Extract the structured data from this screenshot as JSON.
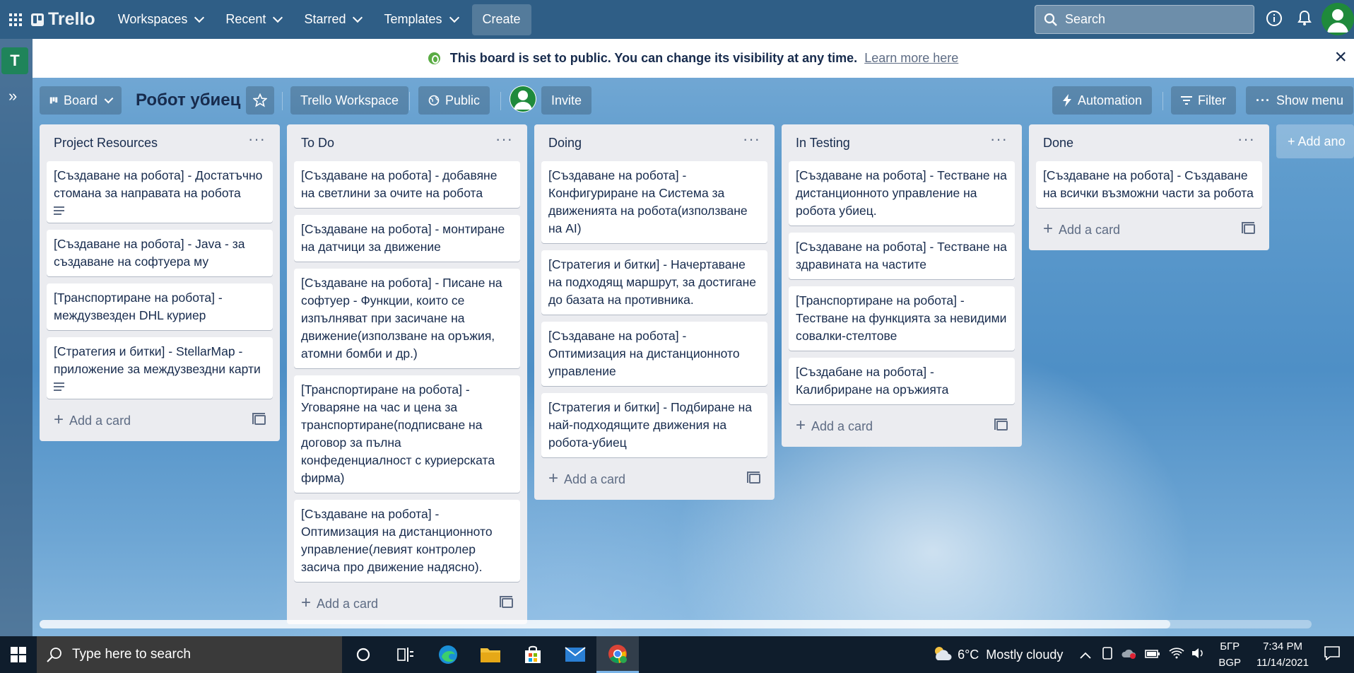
{
  "topnav": {
    "logo": "Trello",
    "workspaces": "Workspaces",
    "recent": "Recent",
    "starred": "Starred",
    "templates": "Templates",
    "create": "Create",
    "search_placeholder": "Search"
  },
  "sidebar": {
    "workspace_initial": "T"
  },
  "banner": {
    "message": "This board is set to public. You can change its visibility at any time.",
    "link": "Learn more here"
  },
  "boardbar": {
    "view": "Board",
    "title": "Робот убиец",
    "workspace": "Trello Workspace",
    "visibility": "Public",
    "invite": "Invite",
    "automation": "Automation",
    "filter": "Filter",
    "show_menu": "Show menu"
  },
  "lists": [
    {
      "title": "Project Resources",
      "cards": [
        {
          "text": "[Създаване на робота] - Достатъчно стомана за направата на робота",
          "desc": true
        },
        {
          "text": "[Създаване на робота] - Java - за създаване на софтуера му",
          "desc": false
        },
        {
          "text": "[Транспортиране на робота] - междузвезден DHL куриер",
          "desc": false
        },
        {
          "text": "[Стратегия и битки] - StellarMap - приложение за междузвездни карти",
          "desc": true
        }
      ],
      "add_card": "Add a card"
    },
    {
      "title": "To Do",
      "cards": [
        {
          "text": "[Създаване на робота] - добавяне на светлини за очите на робота",
          "desc": false
        },
        {
          "text": "[Създаване на робота] - монтиране на датчици за движение",
          "desc": false
        },
        {
          "text": "[Създаване на робота] - Писане на софтуер - Функции, които се изпълняват при засичане на движение(използване на оръжия, атомни бомби и др.)",
          "desc": false
        },
        {
          "text": "[Транспортиране на робота] - Уговаряне на час и цена за транспортиране(подписване на договор за пълна конфеденциалност с куриерската фирма)",
          "desc": false
        },
        {
          "text": "[Създаване на робота] - Оптимизация на дистанционното управление(левият контролер засича про движение надясно).",
          "desc": false
        }
      ],
      "add_card": "Add a card"
    },
    {
      "title": "Doing",
      "cards": [
        {
          "text": "[Създаване на робота] - Конфигуриране на Система за движенията на робота(използване на AI)",
          "desc": false
        },
        {
          "text": "[Стратегия и битки] - Начертаване на подходящ маршрут, за достигане до базата на противника.",
          "desc": false
        },
        {
          "text": "[Създаване на робота] - Оптимизация на дистанционното управление",
          "desc": false
        },
        {
          "text": "[Стратегия и битки] - Подбиране на най-подходящите движения на робота-убиец",
          "desc": false
        }
      ],
      "add_card": "Add a card"
    },
    {
      "title": "In Testing",
      "cards": [
        {
          "text": "[Създаване на робота] - Тестване на дистанционното управление на робота убиец.",
          "desc": false
        },
        {
          "text": "[Създаване на робота] - Тестване на здравината на частите",
          "desc": false
        },
        {
          "text": "[Транспортиране на робота] - Тестване на функцията за невидими совалки-стелтове",
          "desc": false
        },
        {
          "text": "[Създабане на робота] - Калибриране на оръжията",
          "desc": false
        }
      ],
      "add_card": "Add a card"
    },
    {
      "title": "Done",
      "cards": [
        {
          "text": "[Създаване на робота] - Създаване на всички възможни части за робота",
          "desc": false
        }
      ],
      "add_card": "Add a card"
    }
  ],
  "add_list": "+ Add ano",
  "taskbar": {
    "search_placeholder": "Type here to search",
    "weather": "6°C  Mostly cloudy",
    "lang1": "БГР",
    "lang2": "BGP",
    "time": "7:34 PM",
    "date": "11/14/2021"
  },
  "colors": {
    "nav": "#2f5e86",
    "list": "#ebecf0",
    "accent_green": "#1f845a"
  }
}
